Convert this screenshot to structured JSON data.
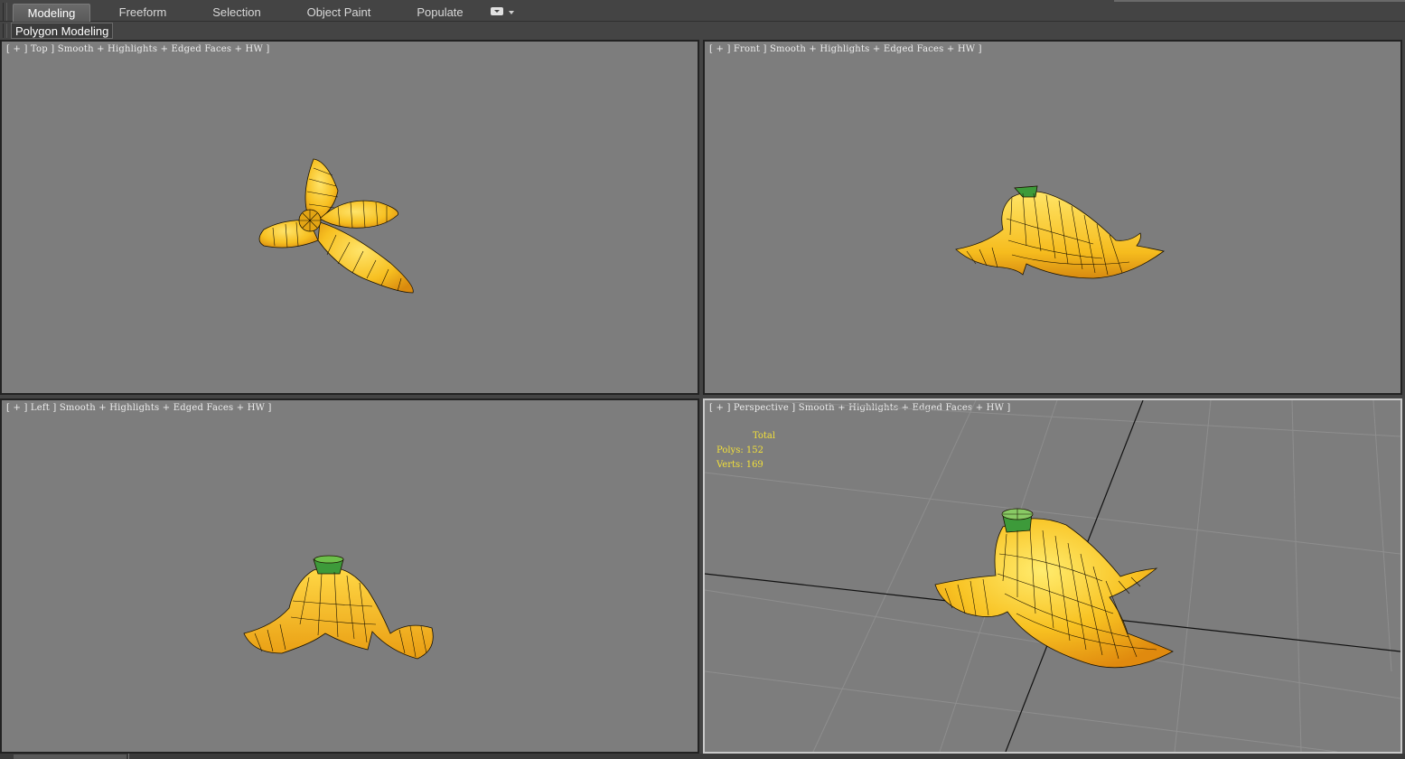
{
  "ribbon": {
    "tabs": [
      {
        "label": "Modeling",
        "active": true
      },
      {
        "label": "Freeform",
        "active": false
      },
      {
        "label": "Selection",
        "active": false
      },
      {
        "label": "Object Paint",
        "active": false
      },
      {
        "label": "Populate",
        "active": false
      }
    ],
    "menu_icon": "ribbon-options-icon"
  },
  "subribbon": {
    "panel_label": "Polygon Modeling"
  },
  "viewports": {
    "top": {
      "label": "[ + ] Top ] Smooth + Highlights + Edged Faces + HW ]"
    },
    "front": {
      "label": "[ + ] Front ] Smooth + Highlights + Edged Faces + HW ]"
    },
    "left": {
      "label": "[ + ] Left ] Smooth + Highlights + Edged Faces + HW ]"
    },
    "perspective": {
      "label": "[ + ] Perspective ] Smooth + Highlights + Edged Faces + HW ]",
      "stats": {
        "title": "Total",
        "polys": "Polys: 152",
        "verts": "Verts: 169"
      }
    }
  },
  "colors": {
    "viewport_bg": "#7d7d7d",
    "banana_yellow": "#f5bf1f",
    "banana_edge": "#1a1200",
    "stem_green": "#3d9a3a",
    "stats_text": "#f2e03a"
  }
}
